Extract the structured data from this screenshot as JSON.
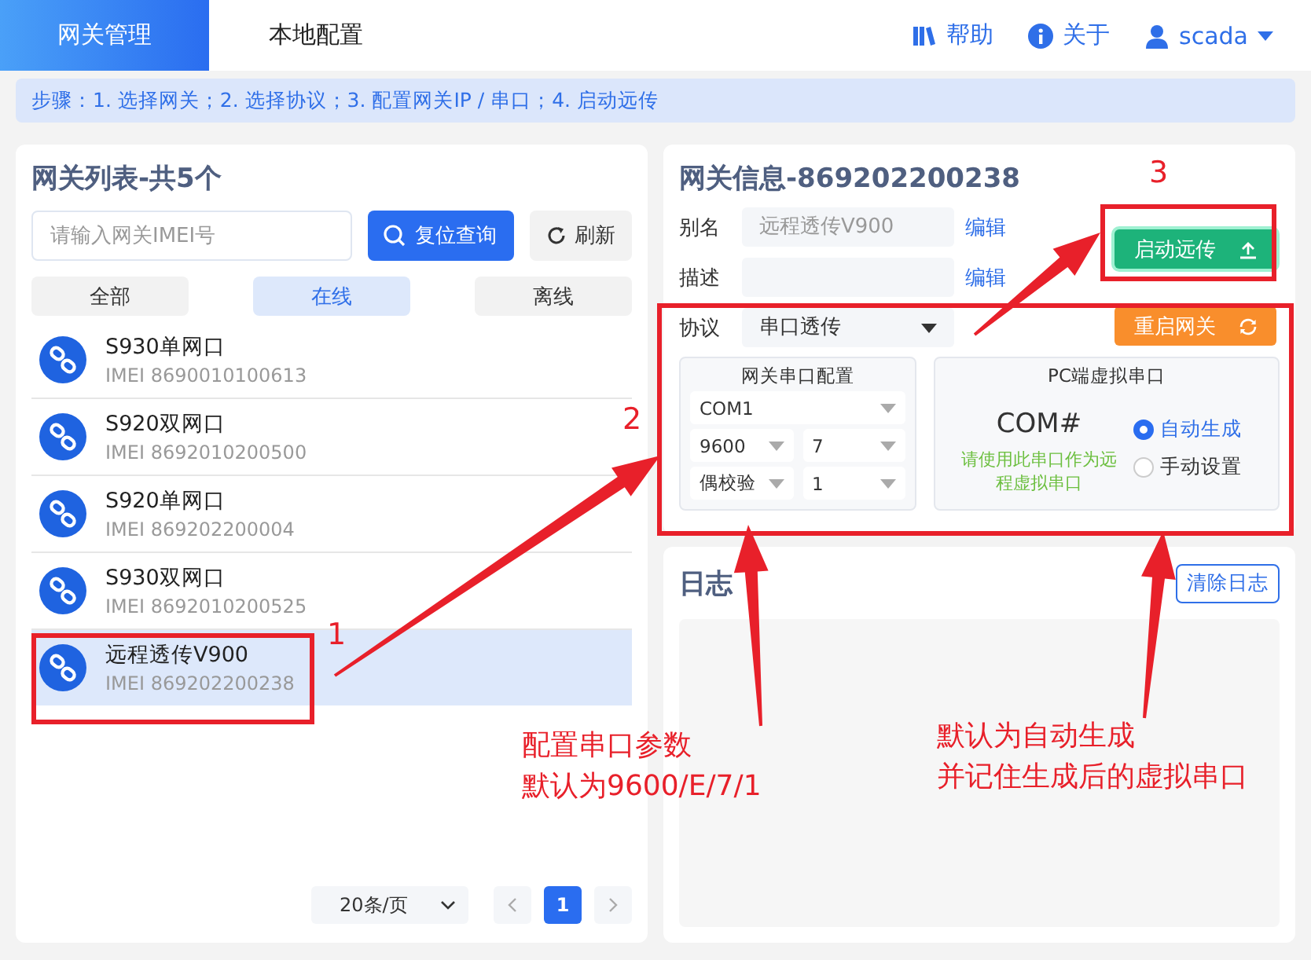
{
  "header": {
    "tabs": [
      {
        "label": "网关管理",
        "selected": true
      },
      {
        "label": "本地配置",
        "selected": false
      }
    ],
    "links": [
      {
        "kind": "help",
        "label": "帮助"
      },
      {
        "kind": "about",
        "label": "关于"
      },
      {
        "kind": "user",
        "label": "scada"
      }
    ]
  },
  "steps": "步骤：1. 选择网关；2. 选择协议；3. 配置网关IP / 串口；4. 启动远传",
  "gateway_list": {
    "title": "网关列表-共5个",
    "search": {
      "placeholder": "请输入网关IMEI号"
    },
    "buttons": [
      {
        "kind": "search",
        "label": "复位查询"
      },
      {
        "kind": "refresh",
        "label": "刷新"
      }
    ],
    "filters": [
      {
        "label": "全部",
        "selected": false
      },
      {
        "label": "在线",
        "selected": true
      },
      {
        "label": "离线",
        "selected": false
      }
    ],
    "items": [
      {
        "name": "S930单网口",
        "imei": "IMEI 8690010100613",
        "selected": false
      },
      {
        "name": "S920双网口",
        "imei": "IMEI 8692010200500",
        "selected": false
      },
      {
        "name": "S920单网口",
        "imei": "IMEI 869202200004",
        "selected": false
      },
      {
        "name": "S930双网口",
        "imei": "IMEI 8692010200525",
        "selected": false
      },
      {
        "name": "远程透传V900",
        "imei": "IMEI 869202200238",
        "selected": true
      }
    ],
    "pagination": {
      "page_size": "20条/页",
      "pages": [
        {
          "label": "1",
          "selected": true
        }
      ]
    }
  },
  "gateway_info": {
    "title": "网关信息-869202200238",
    "fields": [
      {
        "label": "别名",
        "value": "远程透传V900",
        "action": "编辑"
      },
      {
        "label": "描述",
        "action": "编辑"
      }
    ],
    "protocol": {
      "label": "协议",
      "value": "串口透传"
    },
    "actions": [
      {
        "kind": "start",
        "label": "启动远传"
      },
      {
        "kind": "restart",
        "label": "重启网关"
      }
    ],
    "serial_config": {
      "title": "网关串口配置",
      "port": "COM1",
      "baud": "9600",
      "data_bits": "7",
      "parity": "偶校验",
      "stop_bits": "1"
    },
    "virtual_port": {
      "title": "PC端虚拟串口",
      "port": "COM#",
      "hint": "请使用此串口作为远程虚拟串口",
      "modes": [
        {
          "label": "自动生成",
          "selected": true
        },
        {
          "label": "手动设置",
          "selected": false
        }
      ]
    }
  },
  "log": {
    "title": "日志",
    "button": "清除日志"
  },
  "annotations": {
    "markers": [
      "1",
      "2",
      "3"
    ],
    "notes": [
      {
        "lines": [
          "配置串口参数",
          "默认为9600/E/7/1"
        ]
      },
      {
        "lines": [
          "默认为自动生成",
          "并记住生成后的虚拟串口"
        ]
      }
    ]
  }
}
